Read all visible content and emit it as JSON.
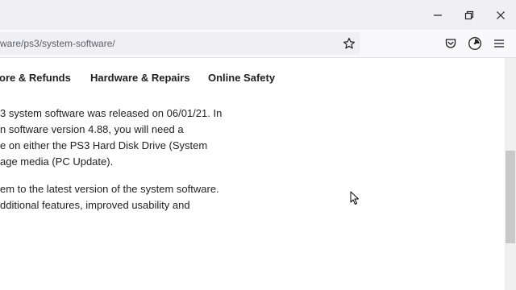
{
  "window": {
    "minimize_icon": "minimize-icon",
    "restore_icon": "restore-icon",
    "close_icon": "close-icon"
  },
  "toolbar": {
    "url": "ware/ps3/system-software/",
    "bookmark_icon": "star-icon",
    "pocket_icon": "pocket-icon",
    "account_icon": "account-icon",
    "menu_icon": "hamburger-menu-icon"
  },
  "nav": {
    "items": [
      {
        "label": "ore & Refunds"
      },
      {
        "label": "Hardware & Repairs"
      },
      {
        "label": "Online Safety"
      }
    ]
  },
  "article": {
    "paragraph1": [
      "3 system software was released on 06/01/21. In",
      "n software version 4.88, you will need a",
      "e on either the PS3 Hard Disk Drive (System",
      "age media (PC Update)."
    ],
    "paragraph2": [
      "em to the latest version of the system software.",
      "dditional features, improved usability and"
    ]
  }
}
